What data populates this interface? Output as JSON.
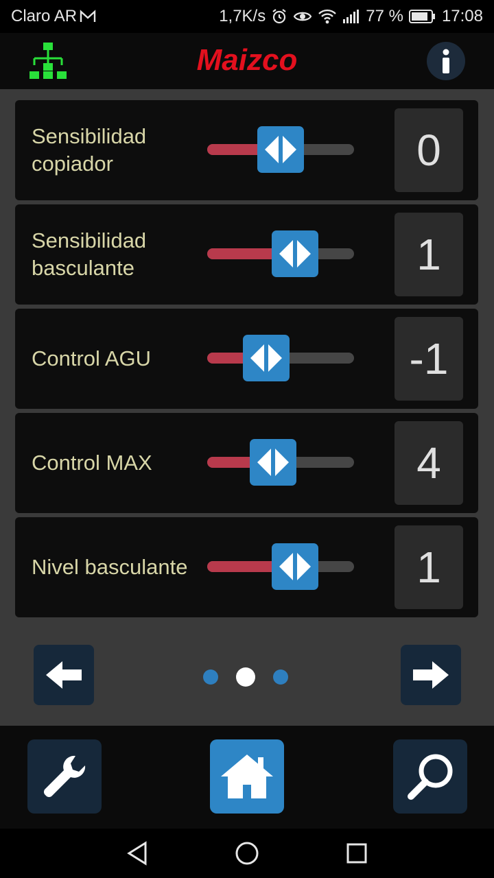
{
  "status": {
    "carrier": "Claro AR",
    "speed": "1,7K/s",
    "battery": "77 %",
    "time": "17:08"
  },
  "header": {
    "logo_text": "Maizco",
    "left_icon": "network-tree-icon",
    "right_icon": "info-icon"
  },
  "settings": [
    {
      "label": "Sensibilidad copiador",
      "value": "0",
      "level": 0.5
    },
    {
      "label": "Sensibilidad basculante",
      "value": "1",
      "level": 0.6
    },
    {
      "label": "Control AGU",
      "value": "-1",
      "level": 0.4
    },
    {
      "label": "Control MAX",
      "value": "4",
      "level": 0.45
    },
    {
      "label": "Nivel basculante",
      "value": "1",
      "level": 0.6
    }
  ],
  "pager": {
    "pages": 3,
    "current": 2
  },
  "toolbar": {
    "tools": [
      "wrench-icon",
      "home-icon",
      "search-icon"
    ],
    "active": "home-icon"
  },
  "colors": {
    "accent": "#2e86c6",
    "slider_fill": "#b83a4c",
    "label": "#d8d6a8",
    "brand": "#e3101e"
  }
}
